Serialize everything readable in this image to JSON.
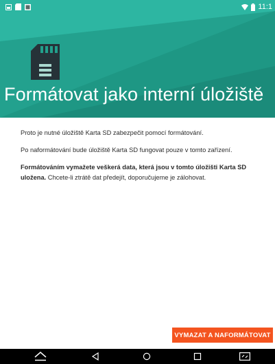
{
  "status_bar": {
    "time": "11:1",
    "left_icons": [
      "image-icon",
      "sd-card-status-icon",
      "photo-icon"
    ],
    "right_icons": [
      "wifi-icon",
      "battery-icon"
    ]
  },
  "header": {
    "icon": "sd-card-icon",
    "title": "Formátovat jako interní úložiště",
    "background_color": "#22a08c"
  },
  "content": {
    "paragraph_1": "Proto je nutné úložiště Karta SD zabezpečit pomocí formátování.",
    "paragraph_2": "Po naformátování bude úložiště Karta SD fungovat pouze v tomto zařízení.",
    "paragraph_3_bold": "Formátováním vymažete veškerá data, která jsou v tomto úložišti Karta SD uložena.",
    "paragraph_3_normal": " Chcete-li ztrátě dat předejít, doporučujeme je zálohovat."
  },
  "action": {
    "label": "VYMAZAT A NAFORMÁTOVAT",
    "color": "#f4541f"
  },
  "nav_bar": {
    "buttons": [
      "home-icon",
      "back-icon",
      "circle-home-icon",
      "recents-icon",
      "screenshot-icon"
    ]
  }
}
